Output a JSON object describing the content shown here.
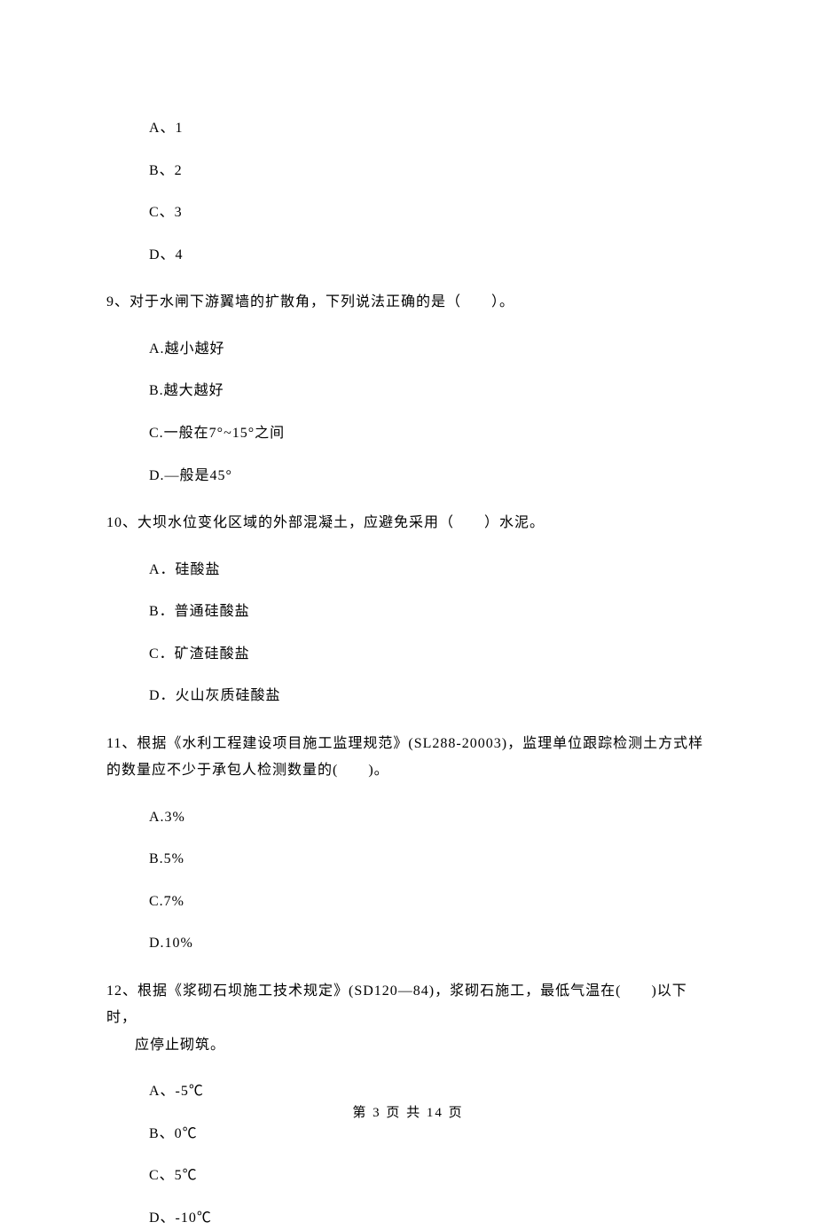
{
  "q8": {
    "options": {
      "a": "A、1",
      "b": "B、2",
      "c": "C、3",
      "d": "D、4"
    }
  },
  "q9": {
    "stem": "9、对于水闸下游翼墙的扩散角，下列说法正确的是（　　）。",
    "options": {
      "a": "A.越小越好",
      "b": "B.越大越好",
      "c": "C.一般在7°~15°之间",
      "d": "D.—般是45°"
    }
  },
  "q10": {
    "stem": "10、大坝水位变化区域的外部混凝土，应避免采用（　　）水泥。",
    "options": {
      "a": "A．硅酸盐",
      "b": "B．普通硅酸盐",
      "c": "C．矿渣硅酸盐",
      "d": "D．火山灰质硅酸盐"
    }
  },
  "q11": {
    "stem": "11、根据《水利工程建设项目施工监理规范》(SL288-20003)，监理单位跟踪检测土方式样的数量应不少于承包人检测数量的(　　)。",
    "options": {
      "a": "A.3%",
      "b": "B.5%",
      "c": "C.7%",
      "d": "D.10%"
    }
  },
  "q12": {
    "stem_line1": "12、根据《浆砌石坝施工技术规定》(SD120—84)，浆砌石施工，最低气温在(　　)以下时，",
    "stem_line2": "应停止砌筑。",
    "options": {
      "a": "A、-5℃",
      "b": "B、0℃",
      "c": "C、5℃",
      "d": "D、-10℃"
    }
  },
  "footer": "第 3 页 共 14 页"
}
